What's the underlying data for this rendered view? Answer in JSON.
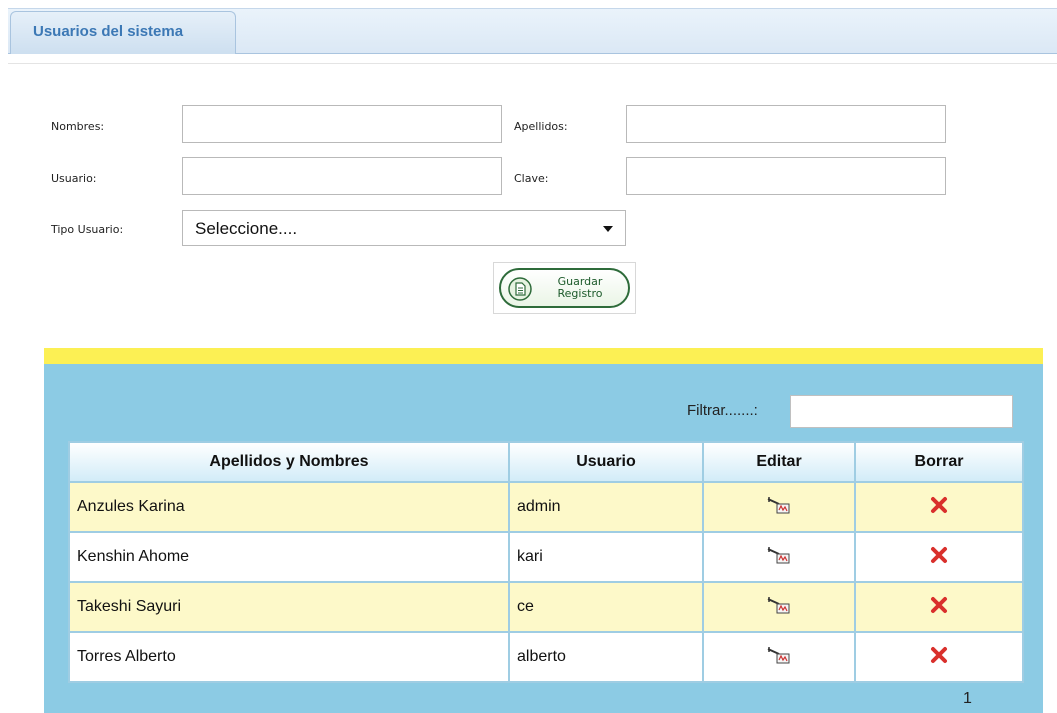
{
  "header": {
    "tab_title": "Usuarios del sistema"
  },
  "form": {
    "nombres": {
      "label": "Nombres:",
      "value": ""
    },
    "apellidos": {
      "label": "Apellidos:",
      "value": ""
    },
    "usuario": {
      "label": "Usuario:",
      "value": ""
    },
    "clave": {
      "label": "Clave:",
      "value": ""
    },
    "tipo_usuario": {
      "label": "Tipo Usuario:",
      "selected": "Seleccione...."
    },
    "save_button": {
      "line1": "Guardar",
      "line2": "Registro"
    }
  },
  "grid": {
    "filter_label": "Filtrar.......:",
    "filter_value": "",
    "columns": [
      "Apellidos y Nombres",
      "Usuario",
      "Editar",
      "Borrar"
    ],
    "rows": [
      {
        "name": "Anzules Karina",
        "user": "admin"
      },
      {
        "name": "Kenshin Ahome",
        "user": "kari"
      },
      {
        "name": "Takeshi Sayuri",
        "user": "ce"
      },
      {
        "name": "Torres Alberto",
        "user": "alberto"
      }
    ],
    "page": "1",
    "edit_icon": "edit-icon",
    "delete_icon": "delete-icon"
  },
  "colors": {
    "tab_text": "#3c78b5",
    "yellow_band": "#fcf054",
    "grid_panel": "#8ccbe4",
    "row_odd": "#fdf9c9",
    "delete_x": "#d9302c"
  }
}
